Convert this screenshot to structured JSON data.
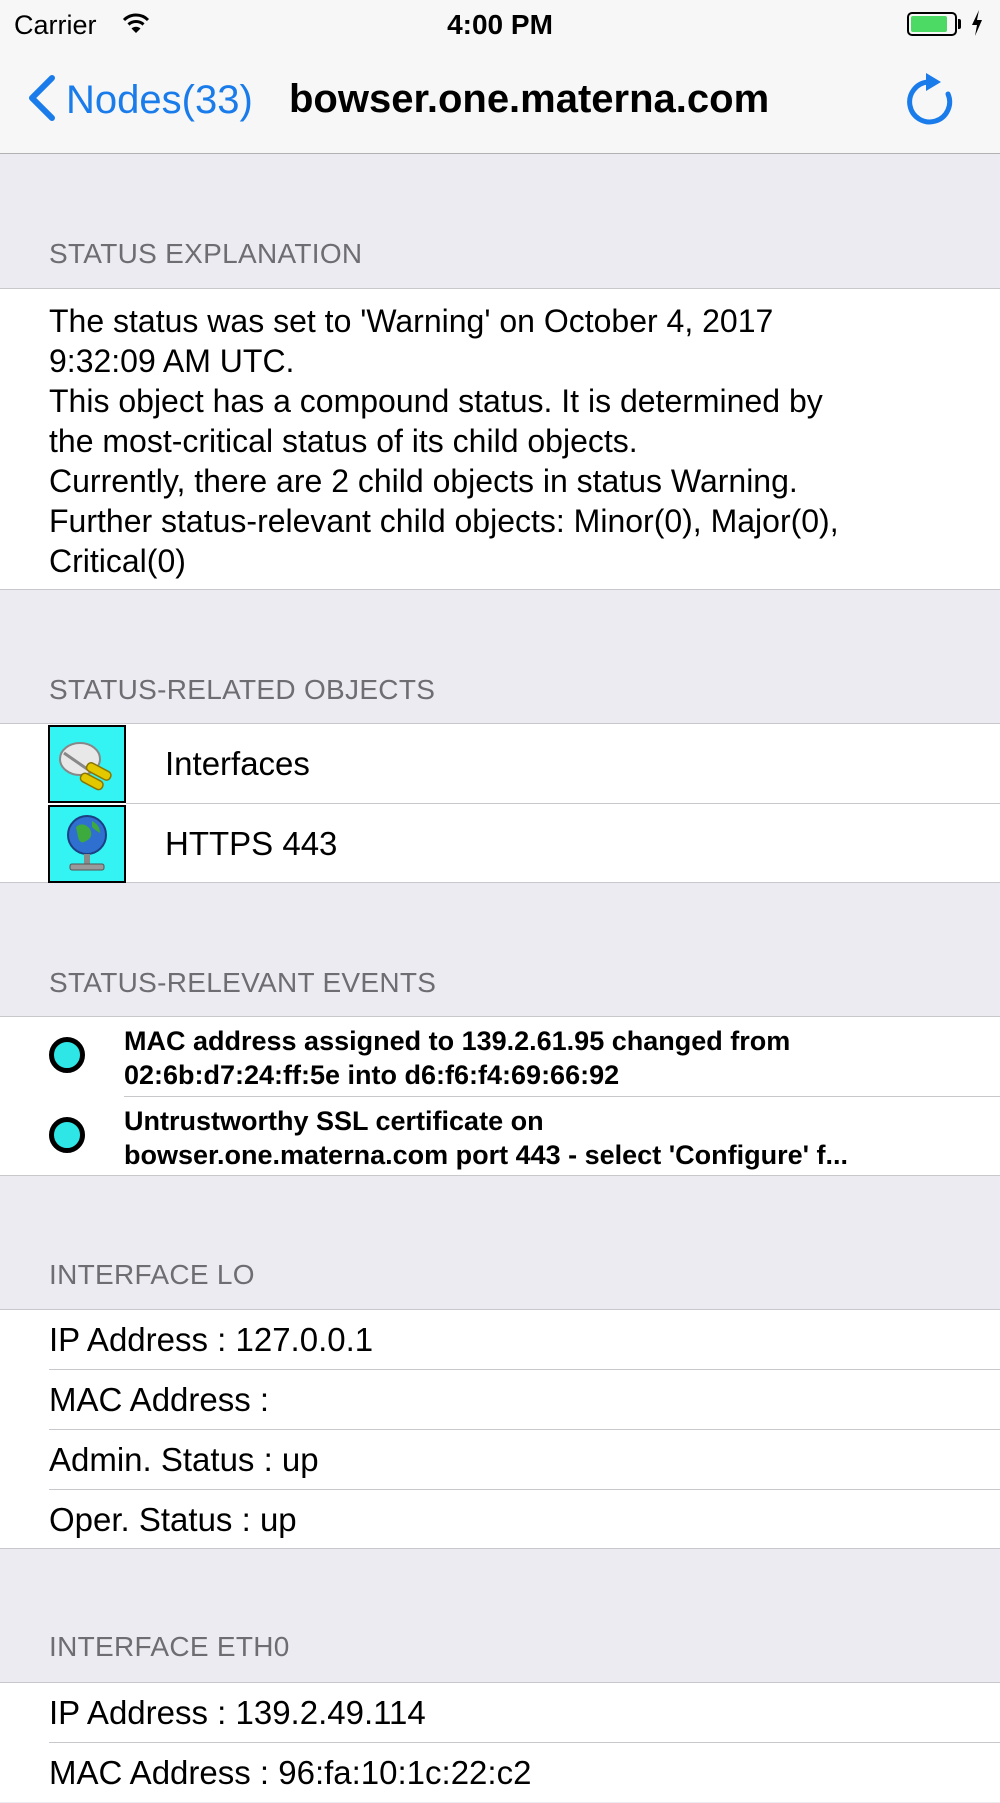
{
  "status_bar": {
    "carrier": "Carrier",
    "time": "4:00 PM",
    "battery_level": 0.85,
    "battery_color": "#4CD964"
  },
  "nav": {
    "back_label": "Nodes(33)",
    "title": "bowser.one.materna.com",
    "back_icon": "chevron-left-icon",
    "refresh_icon": "refresh-icon",
    "accent": "#1A7BEA"
  },
  "sections": {
    "status_explanation": {
      "header": "STATUS EXPLANATION",
      "lines": [
        "The status was set to 'Warning' on October 4, 2017",
        "9:32:09 AM UTC.",
        "This object has a compound status. It is determined by",
        "the most-critical status of its child objects.",
        "Currently, there are 2 child objects in status Warning.",
        "Further status-relevant child objects: Minor(0), Major(0),",
        "Critical(0)"
      ]
    },
    "status_related_objects": {
      "header": "STATUS-RELATED OBJECTS",
      "items": [
        {
          "label": "Interfaces",
          "icon": "interfaces-plug-icon"
        },
        {
          "label": "HTTPS 443",
          "icon": "globe-service-icon"
        }
      ],
      "status_color": "#33F3F3"
    },
    "status_relevant_events": {
      "header": "STATUS-RELEVANT EVENTS",
      "items": [
        {
          "line1": "MAC address assigned to 139.2.61.95 changed from",
          "line2": "02:6b:d7:24:ff:5e into d6:f6:f4:69:66:92"
        },
        {
          "line1": "Untrustworthy SSL certificate on",
          "line2": "bowser.one.materna.com port 443 - select 'Configure' f..."
        }
      ]
    },
    "interface_lo": {
      "header": "INTERFACE LO",
      "rows": [
        "IP Address : 127.0.0.1",
        "MAC Address :",
        "Admin. Status : up",
        "Oper. Status : up"
      ]
    },
    "interface_eth0": {
      "header": "INTERFACE ETH0",
      "rows": [
        "IP Address : 139.2.49.114",
        "MAC Address : 96:fa:10:1c:22:c2"
      ]
    }
  }
}
